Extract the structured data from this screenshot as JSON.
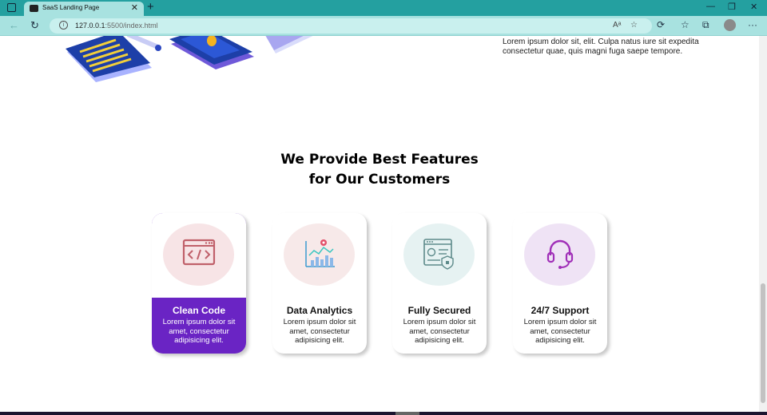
{
  "browser": {
    "tab_title": "SaaS Landing Page",
    "tab_close": "✕",
    "new_tab": "+",
    "url_host": "127.0.0.1",
    "url_path": ":5500/index.html",
    "read_aloud": "Aᵃ",
    "minimize": "—",
    "restore": "❐",
    "close": "✕",
    "more": "···"
  },
  "hero": {
    "text": "Lorem ipsum dolor sit, elit. Culpa natus iure sit expedita consectetur quae, quis magni fuga saepe tempore."
  },
  "features": {
    "heading_line1": "We Provide Best Features",
    "heading_line2": "for Our Customers",
    "cards": [
      {
        "title": "Clean Code",
        "desc": "Lorem ipsum dolor sit amet, consectetur adipisicing elit.",
        "circle_color": "#f7e4e6",
        "active": true
      },
      {
        "title": "Data Analytics",
        "desc": "Lorem ipsum dolor sit amet, consectetur adipisicing elit.",
        "circle_color": "#f7e9e9",
        "active": false
      },
      {
        "title": "Fully Secured",
        "desc": "Lorem ipsum dolor sit amet, consectetur adipisicing elit.",
        "circle_color": "#e6f2f2",
        "active": false
      },
      {
        "title": "24/7 Support",
        "desc": "Lorem ipsum dolor sit amet, consectetur adipisicing elit.",
        "circle_color": "#efe3f5",
        "active": false
      }
    ]
  },
  "colors": {
    "accent": "#6a24c4",
    "browser_frame": "#24a0a0"
  }
}
